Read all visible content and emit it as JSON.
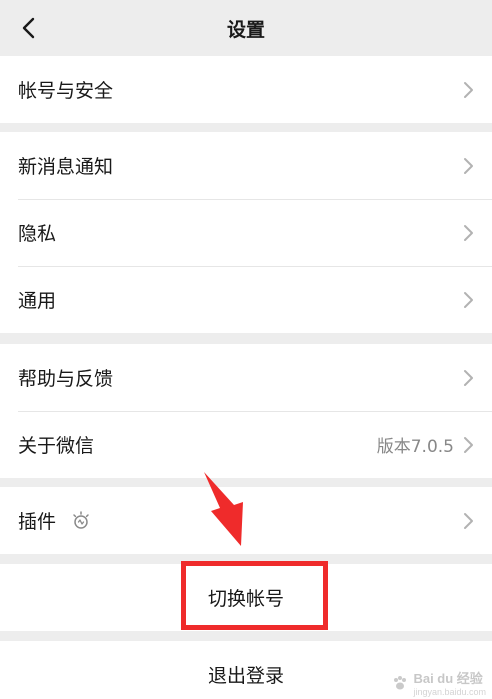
{
  "navbar": {
    "title": "设置",
    "back_icon": "chevron-left-icon"
  },
  "groups": [
    {
      "items": [
        {
          "label": "帐号与安全"
        }
      ]
    },
    {
      "items": [
        {
          "label": "新消息通知"
        },
        {
          "label": "隐私"
        },
        {
          "label": "通用"
        }
      ]
    },
    {
      "items": [
        {
          "label": "帮助与反馈"
        },
        {
          "label": "关于微信",
          "value": "版本7.0.5"
        }
      ]
    },
    {
      "items": [
        {
          "label": "插件",
          "icon": "plugin-lightbulb-icon"
        }
      ]
    }
  ],
  "switch_account": {
    "label": "切换帐号"
  },
  "logout": {
    "label": "退出登录"
  },
  "annotation": {
    "highlight_color": "#ef2b2b"
  },
  "watermark": {
    "text": "Bai du 经验",
    "sub": "jingyan.baidu.com"
  }
}
